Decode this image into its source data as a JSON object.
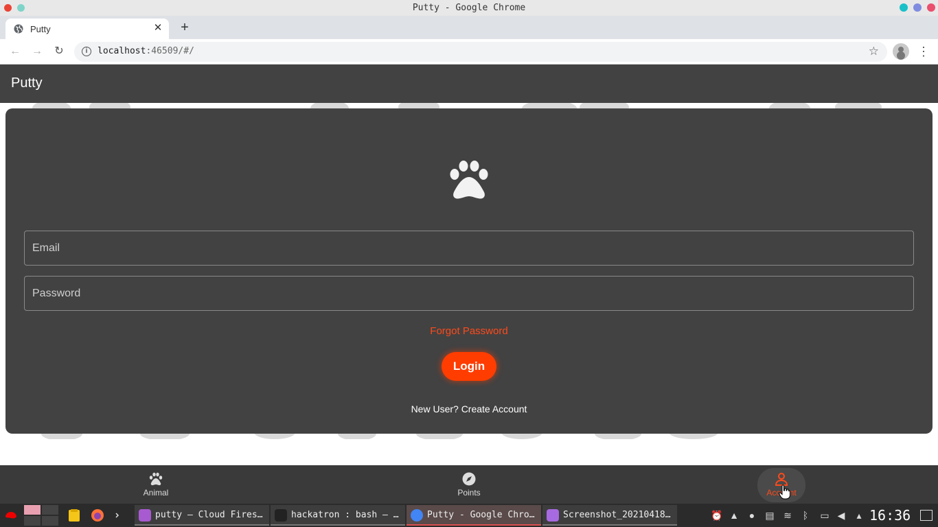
{
  "window": {
    "title": "Putty - Google Chrome"
  },
  "browser": {
    "tab_title": "Putty",
    "url_host": "localhost",
    "url_rest": ":46509/#/"
  },
  "app": {
    "title": "Putty",
    "email_placeholder": "Email",
    "password_placeholder": "Password",
    "forgot_label": "Forgot Password",
    "login_label": "Login",
    "new_user_label": "New User? Create Account"
  },
  "bottom_nav": {
    "items": [
      {
        "label": "Animal",
        "icon": "paw-icon"
      },
      {
        "label": "Points",
        "icon": "compass-icon"
      },
      {
        "label": "Account",
        "icon": "account-icon",
        "active": true
      }
    ]
  },
  "taskbar": {
    "tasks": [
      {
        "label": "putty – Cloud Fires…"
      },
      {
        "label": "hackatron : bash — …"
      },
      {
        "label": "Putty - Google Chro…"
      },
      {
        "label": "Screenshot_20210418…"
      }
    ],
    "clock": "16:36"
  },
  "colors": {
    "accent": "#ff3d00",
    "appbar": "#424242",
    "card": "#424242"
  }
}
